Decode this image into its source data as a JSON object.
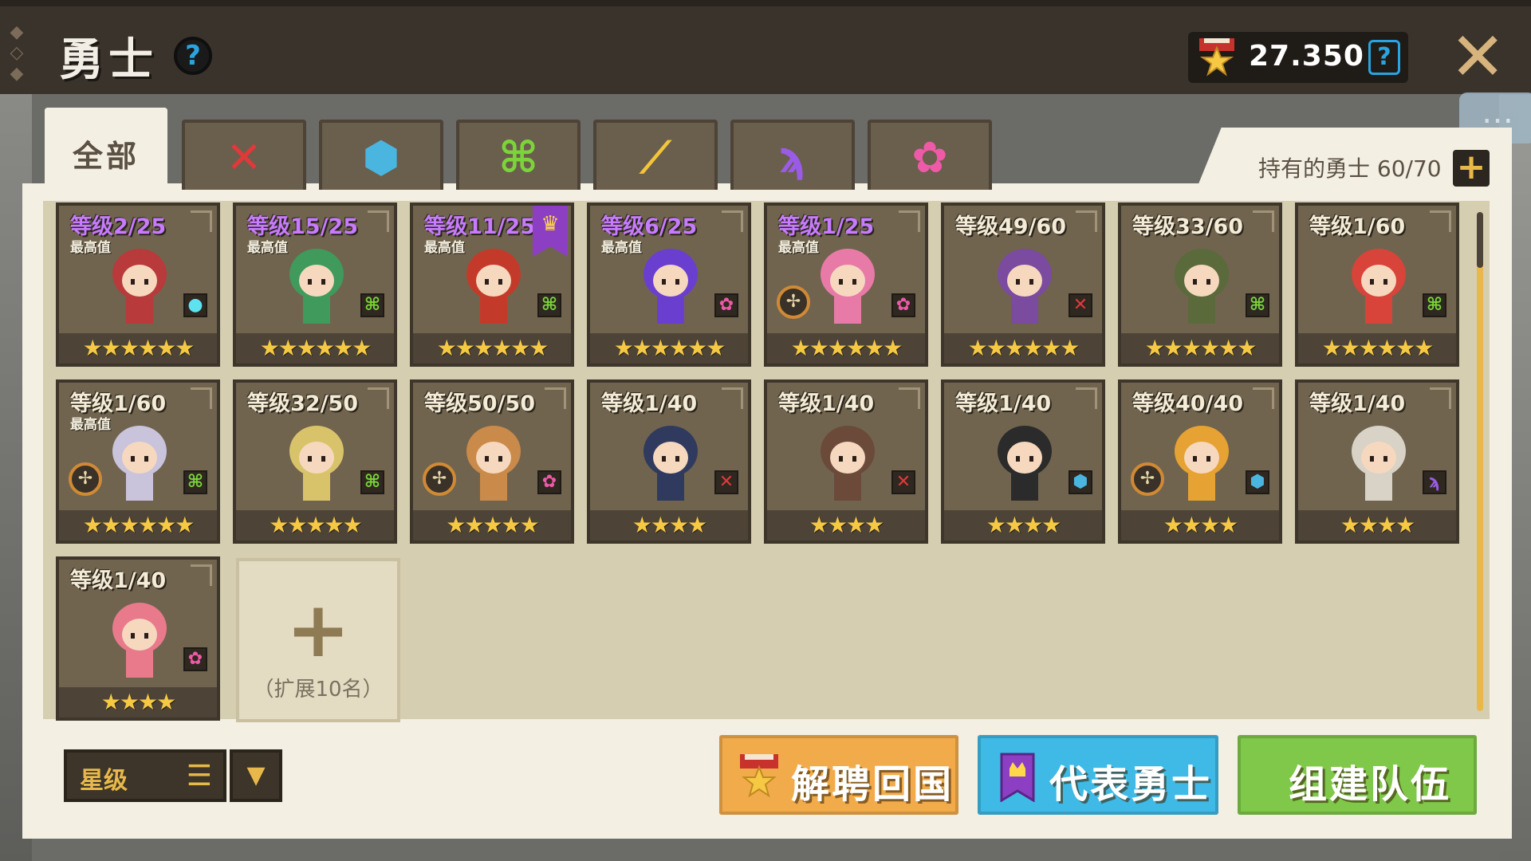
{
  "header": {
    "title": "勇士",
    "help": "?",
    "currency_amount": "27.350",
    "currency_help": "?",
    "close": "✕"
  },
  "tabs": [
    {
      "id": "all",
      "label": "全部",
      "icon": "",
      "color": ""
    },
    {
      "id": "warrior",
      "label": "",
      "icon": "✕",
      "color": "#e0393a"
    },
    {
      "id": "tank",
      "label": "",
      "icon": "⬢",
      "color": "#4ab6e0"
    },
    {
      "id": "archer",
      "label": "",
      "icon": "⌘",
      "color": "#7bd43a"
    },
    {
      "id": "gunner",
      "label": "",
      "icon": "⟋",
      "color": "#f3c53a"
    },
    {
      "id": "mage",
      "label": "",
      "icon": "ϡ",
      "color": "#9a5ce6"
    },
    {
      "id": "healer",
      "label": "",
      "icon": "✿",
      "color": "#ee5aa7"
    }
  ],
  "roster": {
    "label": "持有的勇士 60/70",
    "expand": "+"
  },
  "heroes": [
    {
      "level": "等级2/25",
      "max": true,
      "max_label": "最高值",
      "stars": "★★★★★★",
      "class_icon": "●",
      "class_color": "#5de3f0",
      "compass": false,
      "banner": false,
      "portrait": "#b83a3a"
    },
    {
      "level": "等级15/25",
      "max": true,
      "max_label": "最高值",
      "stars": "★★★★★★",
      "class_icon": "⌘",
      "class_color": "#7bd43a",
      "compass": false,
      "banner": false,
      "portrait": "#3f9a5c"
    },
    {
      "level": "等级11/25",
      "max": true,
      "max_label": "最高值",
      "stars": "★★★★★★",
      "class_icon": "⌘",
      "class_color": "#7bd43a",
      "compass": false,
      "banner": true,
      "portrait": "#c43a2a"
    },
    {
      "level": "等级6/25",
      "max": true,
      "max_label": "最高值",
      "stars": "★★★★★★",
      "class_icon": "✿",
      "class_color": "#ee5aa7",
      "compass": false,
      "banner": false,
      "portrait": "#6a3fd0"
    },
    {
      "level": "等级1/25",
      "max": true,
      "max_label": "最高值",
      "stars": "★★★★★★",
      "class_icon": "✿",
      "class_color": "#ee5aa7",
      "compass": true,
      "banner": false,
      "portrait": "#e87aa8"
    },
    {
      "level": "等级49/60",
      "max": false,
      "max_label": "",
      "stars": "★★★★★★",
      "class_icon": "✕",
      "class_color": "#e0393a",
      "compass": false,
      "banner": false,
      "portrait": "#7a4b9e"
    },
    {
      "level": "等级33/60",
      "max": false,
      "max_label": "",
      "stars": "★★★★★★",
      "class_icon": "⌘",
      "class_color": "#7bd43a",
      "compass": false,
      "banner": false,
      "portrait": "#5a6a3a"
    },
    {
      "level": "等级1/60",
      "max": false,
      "max_label": "",
      "stars": "★★★★★★",
      "class_icon": "⌘",
      "class_color": "#7bd43a",
      "compass": false,
      "banner": false,
      "portrait": "#d8433a"
    },
    {
      "level": "等级1/60",
      "max": false,
      "max_label": "最高值",
      "stars": "★★★★★★",
      "class_icon": "⌘",
      "class_color": "#7bd43a",
      "compass": true,
      "banner": false,
      "portrait": "#c9c3dc"
    },
    {
      "level": "等级32/50",
      "max": false,
      "max_label": "",
      "stars": "★★★★★",
      "class_icon": "⌘",
      "class_color": "#7bd43a",
      "compass": false,
      "banner": false,
      "portrait": "#d9c36a"
    },
    {
      "level": "等级50/50",
      "max": false,
      "max_label": "",
      "stars": "★★★★★",
      "class_icon": "✿",
      "class_color": "#ee5aa7",
      "compass": true,
      "banner": false,
      "portrait": "#c98a4a"
    },
    {
      "level": "等级1/40",
      "max": false,
      "max_label": "",
      "stars": "★★★★",
      "class_icon": "✕",
      "class_color": "#e0393a",
      "compass": false,
      "banner": false,
      "portrait": "#2f3a5e"
    },
    {
      "level": "等级1/40",
      "max": false,
      "max_label": "",
      "stars": "★★★★",
      "class_icon": "✕",
      "class_color": "#e0393a",
      "compass": false,
      "banner": false,
      "portrait": "#6b4a3a"
    },
    {
      "level": "等级1/40",
      "max": false,
      "max_label": "",
      "stars": "★★★★",
      "class_icon": "⬢",
      "class_color": "#4ab6e0",
      "compass": false,
      "banner": false,
      "portrait": "#2b2b2b"
    },
    {
      "level": "等级40/40",
      "max": false,
      "max_label": "",
      "stars": "★★★★",
      "class_icon": "⬢",
      "class_color": "#4ab6e0",
      "compass": true,
      "banner": false,
      "portrait": "#e6a232"
    },
    {
      "level": "等级1/40",
      "max": false,
      "max_label": "",
      "stars": "★★★★",
      "class_icon": "ϡ",
      "class_color": "#9a5ce6",
      "compass": false,
      "banner": false,
      "portrait": "#d8d3c6"
    },
    {
      "level": "等级1/40",
      "max": false,
      "max_label": "",
      "stars": "★★★★",
      "class_icon": "✿",
      "class_color": "#ee5aa7",
      "compass": false,
      "banner": false,
      "portrait": "#e87a8c"
    }
  ],
  "expand_slot": {
    "plus": "+",
    "caption": "（扩展10名）"
  },
  "sort": {
    "label": "星级",
    "list_icon": "☰",
    "dropdown_icon": "▼"
  },
  "actions": {
    "dismiss": "解聘回国",
    "representative": "代表勇士",
    "build_team": "组建队伍"
  }
}
